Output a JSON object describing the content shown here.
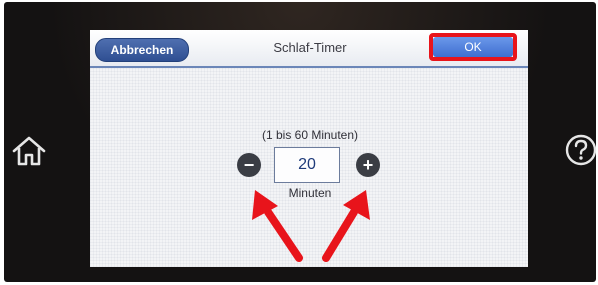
{
  "dialog": {
    "cancel_label": "Abbrechen",
    "title": "Schlaf-Timer",
    "ok_label": "OK"
  },
  "timer": {
    "range_label": "(1 bis 60 Minuten)",
    "value": "20",
    "unit": "Minuten",
    "minus_symbol": "−",
    "plus_symbol": "+"
  },
  "colors": {
    "annotation_red": "#e8141b",
    "cancel_blue": "#2f4f92",
    "ok_blue": "#4f80dc"
  },
  "icons": [
    "home-icon",
    "help-icon",
    "minus-icon",
    "plus-icon"
  ]
}
